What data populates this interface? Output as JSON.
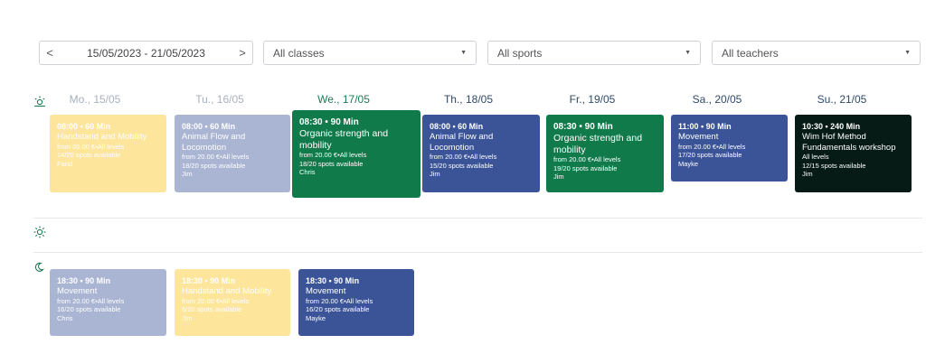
{
  "filters": {
    "date_range": "15/05/2023 - 21/05/2023",
    "prev_arrow": "<",
    "next_arrow": ">",
    "classes": "All classes",
    "sports": "All sports",
    "teachers": "All teachers",
    "caret": "▼"
  },
  "days": [
    {
      "label": "Mo., 15/05"
    },
    {
      "label": "Tu., 16/05"
    },
    {
      "label": "We., 17/05"
    },
    {
      "label": "Th., 18/05"
    },
    {
      "label": "Fr., 19/05"
    },
    {
      "label": "Sa., 20/05"
    },
    {
      "label": "Su., 21/05"
    }
  ],
  "morning": [
    {
      "time": "08:00 • 60 Min",
      "title": [
        "Handstand and Mobility"
      ],
      "price": "from 20.00 €•All levels",
      "spots": "14/20 spots available",
      "teacher": "Farid"
    },
    {
      "time": "08:00 • 60 Min",
      "title": [
        "Animal Flow and",
        "Locomotion"
      ],
      "price": "from 20.00 €•All levels",
      "spots": "18/20 spots available",
      "teacher": "Jim"
    },
    {
      "time": "08:30 • 90 Min",
      "title": [
        "Organic strength and",
        "mobility"
      ],
      "price": "from 20.00 €•All levels",
      "spots": "18/20 spots available",
      "teacher": "Chris"
    },
    {
      "time": "08:00 • 60 Min",
      "title": [
        "Animal Flow and",
        "Locomotion"
      ],
      "price": "from 20.00 €•All levels",
      "spots": "15/20 spots available",
      "teacher": "Jim"
    },
    {
      "time": "08:30 • 90 Min",
      "title": [
        "Organic strength and",
        "mobility"
      ],
      "price": "from 20.00 €•All levels",
      "spots": "19/20 spots available",
      "teacher": "Jim"
    },
    {
      "time": "11:00 • 90 Min",
      "title": [
        "Movement"
      ],
      "price": "from 20.00 €•All levels",
      "spots": "17/20 spots available",
      "teacher": "Mayke"
    },
    {
      "time": "10:30 • 240 Min",
      "title": [
        "Wim Hof Method",
        "Fundamentals workshop"
      ],
      "price": "All levels",
      "spots": "12/15 spots available",
      "teacher": "Jim"
    }
  ],
  "evening": [
    {
      "time": "18:30 • 90 Min",
      "title": [
        "Movement"
      ],
      "price": "from 20.00 €•All levels",
      "spots": "16/20 spots available",
      "teacher": "Chris"
    },
    {
      "time": "18:30 • 90 Min",
      "title": [
        "Handstand and Mobility"
      ],
      "price": "from 20.00 €•All levels",
      "spots": "6/20 spots available",
      "teacher": "Jim"
    },
    {
      "time": "18:30 • 90 Min",
      "title": [
        "Movement"
      ],
      "price": "from 20.00 €•All levels",
      "spots": "16/20 spots available",
      "teacher": "Mayke"
    }
  ],
  "colors": {
    "yellow": "#fde59c",
    "lavender": "#aab5d3",
    "green": "#107a4a",
    "blue": "#3b5497",
    "dark": "#061b15"
  },
  "icons": {
    "morning": "sunrise-icon",
    "midday": "sun-icon",
    "evening": "moon-icon"
  }
}
